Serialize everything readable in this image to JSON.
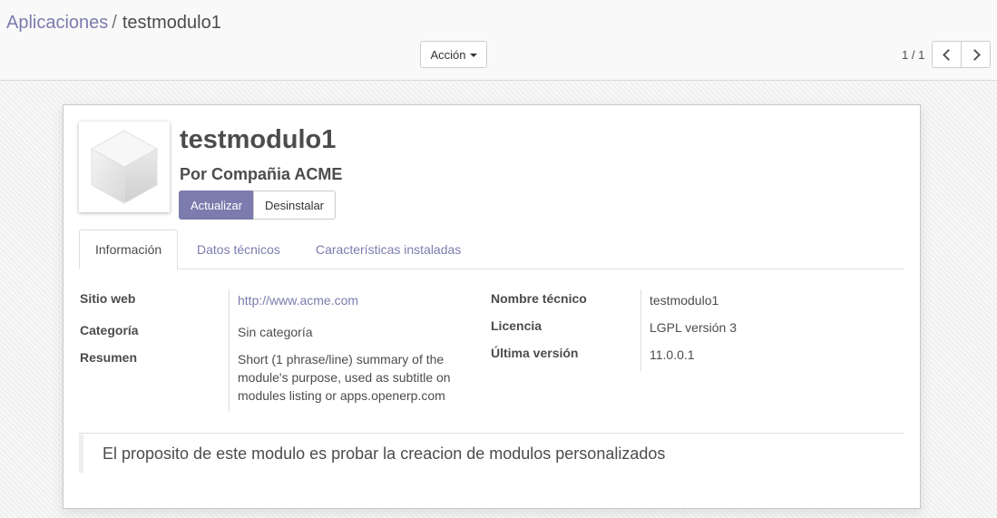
{
  "breadcrumb": {
    "parent": "Aplicaciones",
    "separator": "/",
    "current": "testmodulo1"
  },
  "toolbar": {
    "action_label": "Acción"
  },
  "pager": {
    "value": "1 / 1"
  },
  "module": {
    "name": "testmodulo1",
    "author": "Por Compañia ACME",
    "icon": "cube-icon"
  },
  "buttons": {
    "upgrade": "Actualizar",
    "uninstall": "Desinstalar"
  },
  "tabs": [
    {
      "label": "Información",
      "active": true
    },
    {
      "label": "Datos técnicos",
      "active": false
    },
    {
      "label": "Características instaladas",
      "active": false
    }
  ],
  "info": {
    "website_label": "Sitio web",
    "website_value": "http://www.acme.com",
    "category_label": "Categoría",
    "category_value": "Sin categoría",
    "summary_label": "Resumen",
    "summary_value_lines": [
      "Short (1 phrase/line) summary of the",
      "module's purpose, used as subtitle on",
      "modules listing or apps.openerp.com"
    ],
    "technical_name_label": "Nombre técnico",
    "technical_name_value": "testmodulo1",
    "license_label": "Licencia",
    "license_value": "LGPL versión 3",
    "latest_version_label": "Última versión",
    "latest_version_value": "11.0.0.1"
  },
  "description": "El proposito de este modulo es probar la creacion de modulos personalizados",
  "colors": {
    "accent": "#7c7bad",
    "text": "#4c4c4c",
    "border": "#dddddd"
  }
}
